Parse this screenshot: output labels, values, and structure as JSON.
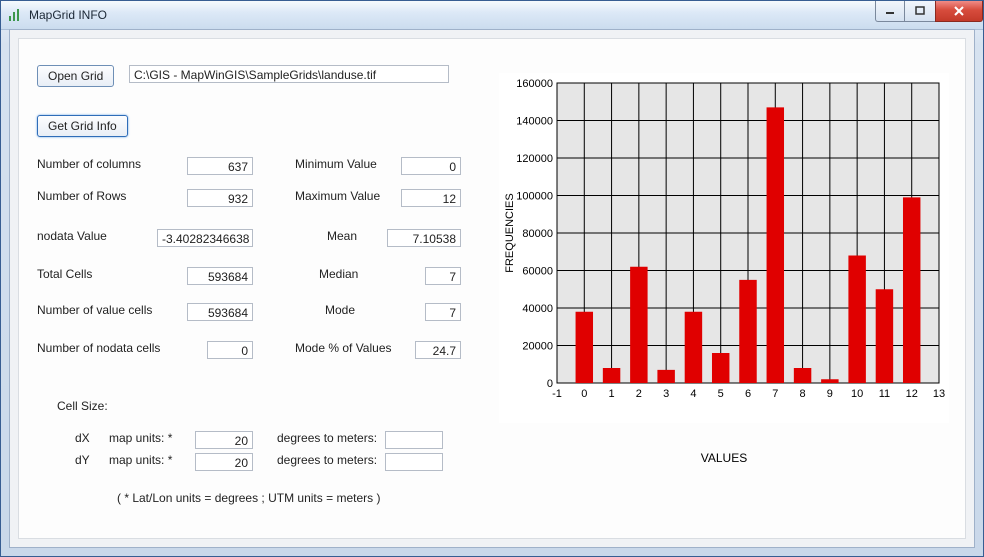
{
  "window": {
    "title": "MapGrid INFO"
  },
  "toolbar": {
    "open_grid": "Open Grid",
    "get_grid_info": "Get Grid Info",
    "path": "C:\\GIS - MapWinGIS\\SampleGrids\\landuse.tif"
  },
  "fields": {
    "num_columns_label": "Number of columns",
    "num_columns": "637",
    "num_rows_label": "Number of  Rows",
    "num_rows": "932",
    "nodata_label": "nodata Value",
    "nodata": "-3.40282346638",
    "total_cells_label": "Total Cells",
    "total_cells": "593684",
    "value_cells_label": "Number of  value cells",
    "value_cells": "593684",
    "nodata_cells_label": "Number of  nodata cells",
    "nodata_cells": "0",
    "min_label": "Minimum Value",
    "min": "0",
    "max_label": "Maximum Value",
    "max": "12",
    "mean_label": "Mean",
    "mean": "7.10538",
    "median_label": "Median",
    "median": "7",
    "mode_label": "Mode",
    "mode": "7",
    "modepct_label": "Mode % of Values",
    "modepct": "24.7",
    "cellsize_label": "Cell Size:",
    "dx_label": "dX",
    "dy_label": "dY",
    "mapunits_label": "map units: *",
    "dx": "20",
    "dy": "20",
    "deg2m_label": "degrees to meters:",
    "deg2m_x": "",
    "deg2m_y": "",
    "footnote": "( * Lat/Lon units = degrees ;   UTM units = meters )"
  },
  "chart_data": {
    "type": "bar",
    "title": "",
    "xlabel": "VALUES",
    "ylabel": "FREQUENCIES",
    "xlim": [
      -1,
      13
    ],
    "ylim": [
      0,
      160000
    ],
    "yticks": [
      0,
      20000,
      40000,
      60000,
      80000,
      100000,
      120000,
      140000,
      160000
    ],
    "xticks": [
      -1,
      0,
      1,
      2,
      3,
      4,
      5,
      6,
      7,
      8,
      9,
      10,
      11,
      12,
      13
    ],
    "categories": [
      0,
      1,
      2,
      3,
      4,
      5,
      6,
      7,
      8,
      9,
      10,
      11,
      12
    ],
    "values": [
      38000,
      8000,
      62000,
      7000,
      38000,
      16000,
      55000,
      147000,
      8000,
      2000,
      68000,
      50000,
      99000
    ]
  }
}
